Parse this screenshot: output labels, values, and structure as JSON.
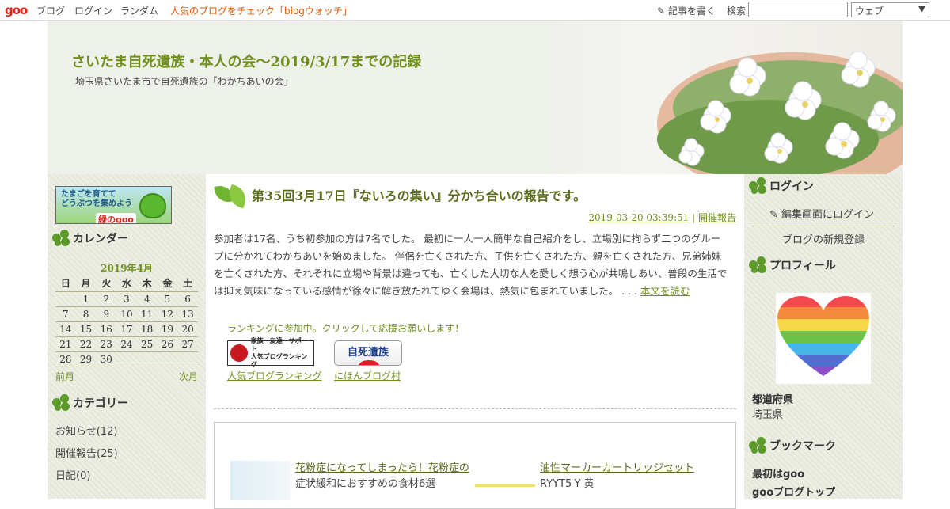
{
  "topbar": {
    "logo": "goo",
    "links": [
      "ブログ",
      "ログイン",
      "ランダム"
    ],
    "promo": "人気のブログをチェック「blogウォッチ」",
    "write": "記事を書く",
    "search_label": "検索",
    "search_placeholder": "",
    "select_value": "ウェブ"
  },
  "header": {
    "title": "さいたま自死遺族・本人の会～2019/3/17までの記録",
    "description": "埼玉県さいたま市で自死遺族の「わかちあいの会」"
  },
  "left": {
    "banner": {
      "line1": "たまごを育てて",
      "line2": "どうぶつを集めよう",
      "goo": "緑のgoo"
    },
    "calendar_heading": "カレンダー",
    "calendar": {
      "month": "2019年4月",
      "weekdays": [
        "日",
        "月",
        "火",
        "水",
        "木",
        "金",
        "土"
      ],
      "weeks": [
        [
          "",
          "1",
          "2",
          "3",
          "4",
          "5",
          "6"
        ],
        [
          "7",
          "8",
          "9",
          "10",
          "11",
          "12",
          "13"
        ],
        [
          "14",
          "15",
          "16",
          "17",
          "18",
          "19",
          "20"
        ],
        [
          "21",
          "22",
          "23",
          "24",
          "25",
          "26",
          "27"
        ],
        [
          "28",
          "29",
          "30",
          "",
          "",
          "",
          ""
        ]
      ],
      "prev": "前月",
      "next": "次月"
    },
    "category_heading": "カテゴリー",
    "categories": [
      "お知らせ(12)",
      "開催報告(25)",
      "日記(0)"
    ]
  },
  "post": {
    "title": "第35回3月17日『ないろの集い』分かち合いの報告です。",
    "datetime": "2019-03-20 03:39:51",
    "category": "開催報告",
    "separator": " | ",
    "body": "参加者は17名、うち初参加の方は7名でした。 最初に一人一人簡単な自己紹介をし、立場別に拘らず二つのグループに分かれてわかちあいを始めました。 伴侶を亡くされた方、子供を亡くされた方、親を亡くされた方、兄弟姉妹を亡くされた方、それぞれに立場や背景は違っても、亡くした大切な人を愛しく想う心が共鳴しあい、普段の生活では抑え気味になっている感情が徐々に解き放たれてゆく会場は、熱気に包まれていました。 . . . ",
    "more": "本文を読む"
  },
  "ranking": {
    "text": "ランキングに参加中。クリックして応援お願いします！",
    "btn1_line1": "家族・友達・サポート",
    "btn1_line2": "人気ブログランキング",
    "btn2": "自死遺族",
    "link1": "人気ブログランキング",
    "link2": "にほんブログ村"
  },
  "ads": [
    {
      "title": "花粉症になってしまったら！花粉症の",
      "sub": "症状緩和におすすめの食材6選"
    },
    {
      "title": "油性マーカーカートリッジセット",
      "sub": "RYYT5-Y 黄"
    }
  ],
  "right": {
    "login_heading": "ログイン",
    "login_link": "編集画面にログイン",
    "register_link": "ブログの新規登録",
    "profile_heading": "プロフィール",
    "pref_label": "都道府県",
    "pref_value": "埼玉県",
    "bookmark_heading": "ブックマーク",
    "bookmarks": [
      "最初はgoo",
      "gooブログトップ"
    ]
  }
}
